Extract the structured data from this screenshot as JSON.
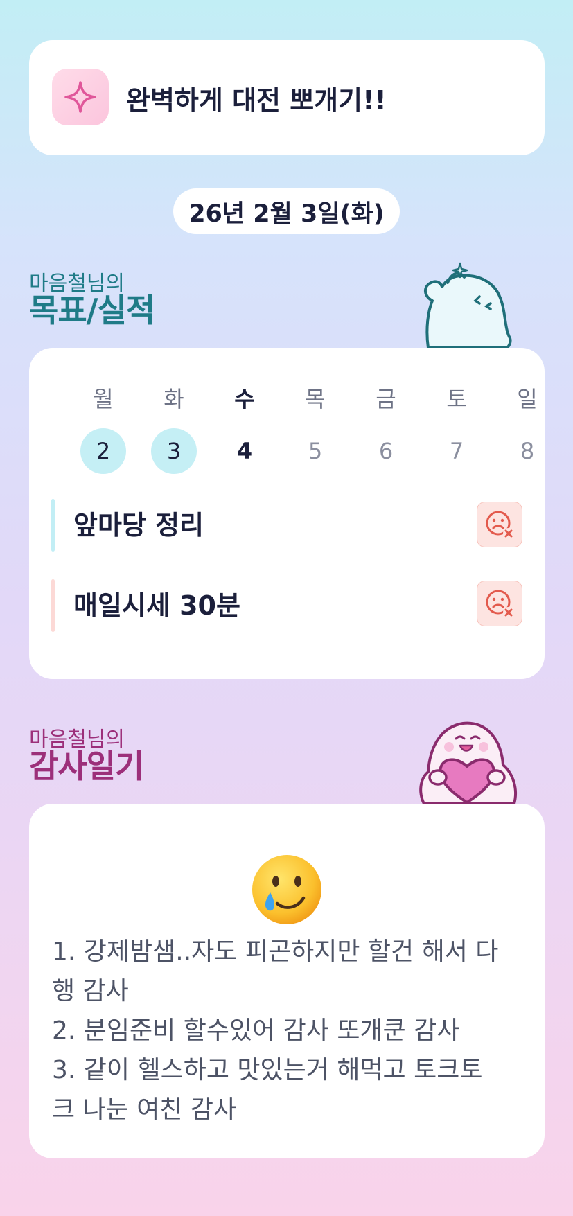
{
  "motto": {
    "icon": "sparkle-icon",
    "text": "완벽하게 대전 뽀개기!!"
  },
  "date": "26년 2월 3일(화)",
  "goals_section": {
    "owner": "마음철님의",
    "title": "목표/실적",
    "mascot": "thumbs-up-ghost-mascot"
  },
  "week": {
    "days": [
      {
        "name": "월",
        "num": "2",
        "state": "done"
      },
      {
        "name": "화",
        "num": "3",
        "state": "done"
      },
      {
        "name": "수",
        "num": "4",
        "state": "today"
      },
      {
        "name": "목",
        "num": "5",
        "state": "future"
      },
      {
        "name": "금",
        "num": "6",
        "state": "future"
      },
      {
        "name": "토",
        "num": "7",
        "state": "future"
      },
      {
        "name": "일",
        "num": "8",
        "state": "future"
      }
    ]
  },
  "goals": [
    {
      "label": "앞마당 정리",
      "accent": "#c2eef5",
      "status_icon": "sad-face-x-icon"
    },
    {
      "label": "매일시세 30분",
      "accent": "#fcd9d6",
      "status_icon": "sad-face-x-icon"
    }
  ],
  "diary_section": {
    "owner": "마음철님의",
    "title": "감사일기",
    "mascot": "heart-holding-ghost-mascot"
  },
  "diary": {
    "emoji": "smiling-face-with-tear-emoji",
    "lines": [
      "1. 강제밤샘..자도 피곤하지만 할건 해서 다\n행 감사",
      "2. 분임준비 할수있어 감사 또개쿤 감사",
      "3. 같이 헬스하고 맛있는거 해먹고 토크토\n크 나눈 여친 감사"
    ]
  },
  "colors": {
    "goals_accent": "#1f7b87",
    "diary_accent": "#9c2f7a",
    "done_day": "#c5eff5",
    "fail_icon": "#e35a4d"
  }
}
